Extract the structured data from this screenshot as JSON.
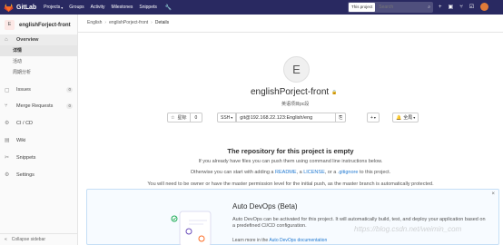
{
  "topbar": {
    "brand": "GitLab",
    "nav": [
      "Projects",
      "Groups",
      "Activity",
      "Milestones",
      "Snippets"
    ],
    "search_scope": "This project",
    "search_placeholder": "Search"
  },
  "sidebar": {
    "project_initial": "E",
    "project_name": "englishForject-front",
    "items": [
      {
        "label": "Overview"
      },
      {
        "label": "Issues",
        "badge": "0"
      },
      {
        "label": "Merge Requests",
        "badge": "0"
      },
      {
        "label": "CI / CD"
      },
      {
        "label": "Wiki"
      },
      {
        "label": "Snippets"
      },
      {
        "label": "Settings"
      }
    ],
    "overview_sub": [
      "详情",
      "活动",
      "周期分析"
    ],
    "collapse": "Collapse sidebar"
  },
  "breadcrumb": [
    "English",
    "englishPorject-front",
    "Details"
  ],
  "project": {
    "initial": "E",
    "title": "englishPorject-front",
    "description": "英语项目pc段"
  },
  "actions": {
    "star_label": "星标",
    "star_count": "0",
    "protocol": "SSH",
    "clone_url": "git@192.168.22.123:English/eng",
    "add_label": "+",
    "notify_label": "全局"
  },
  "empty": {
    "title": "The repository for this project is empty",
    "line1": "If you already have files you can push them using command line instructions below.",
    "line2_prefix": "Otherwise you can start with adding a ",
    "readme": "README",
    "sep1": ", a ",
    "license": "LICENSE",
    "sep2": ", or a ",
    "gitignore": ".gitignore",
    "line2_suffix": " to this project.",
    "line3": "You will need to be owner or have the master permission level for the initial push, as the master branch is automatically protected."
  },
  "devops": {
    "title": "Auto DevOps (Beta)",
    "text": "Auto DevOps can be activated for this project. It will automatically build, test, and deploy your application based on a predefined CI/CD configuration.",
    "link_prefix": "Learn more in the ",
    "link": "Auto DevOps documentation"
  },
  "watermark": "https://blog.csdn.net/weimin_com"
}
